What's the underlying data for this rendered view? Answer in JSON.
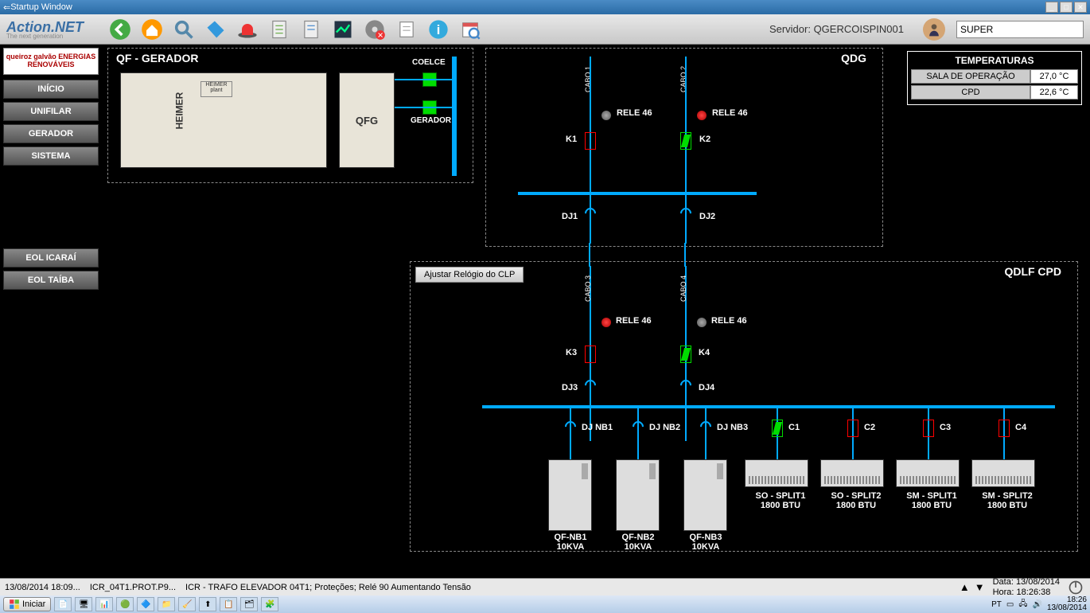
{
  "window": {
    "title": "Startup Window"
  },
  "toolbar": {
    "logo": "Action.NET",
    "logo_sub": "The next generation",
    "server_label": "Servidor: QGERCOISPIN001",
    "user_input": "SUPER"
  },
  "sidebar": {
    "company": "queiroz galvão ENERGIAS RENOVÁVEIS",
    "buttons": [
      "INÍCIO",
      "UNIFILAR",
      "GERADOR",
      "SISTEMA"
    ],
    "eol_buttons": [
      "EOL ICARAÍ",
      "EOL TAÍBA"
    ]
  },
  "panels": {
    "qf_gerador": {
      "title": "QF - GERADOR",
      "gen_label": "HEIMER",
      "gen_plate": "HEIMER plant",
      "qfg": "QFG",
      "coelce": "COELCE",
      "gerador": "GERADOR"
    },
    "qdg": {
      "title": "QDG",
      "cabo1": "CABO 1",
      "cabo2": "CABO 2",
      "rele1": "RELE 46",
      "rele2": "RELE 46",
      "k1": "K1",
      "k2": "K2",
      "dj1": "DJ1",
      "dj2": "DJ2"
    },
    "qdlf": {
      "title": "QDLF CPD",
      "clp_btn": "Ajustar Relógio do CLP",
      "cabo3": "CABO 3",
      "cabo4": "CABO 4",
      "rele3": "RELE 46",
      "rele4": "RELE 46",
      "k3": "K3",
      "k4": "K4",
      "dj3": "DJ3",
      "dj4": "DJ4",
      "djnb1": "DJ NB1",
      "djnb2": "DJ NB2",
      "djnb3": "DJ NB3",
      "c1": "C1",
      "c2": "C2",
      "c3": "C3",
      "c4": "C4",
      "loads": [
        {
          "name": "QF-NB1",
          "sub": "10KVA"
        },
        {
          "name": "QF-NB2",
          "sub": "10KVA"
        },
        {
          "name": "QF-NB3",
          "sub": "10KVA"
        }
      ],
      "ac_units": [
        {
          "name": "SO - SPLIT1",
          "sub": "1800 BTU"
        },
        {
          "name": "SO - SPLIT2",
          "sub": "1800 BTU"
        },
        {
          "name": "SM - SPLIT1",
          "sub": "1800 BTU"
        },
        {
          "name": "SM - SPLIT2",
          "sub": "1800 BTU"
        }
      ]
    }
  },
  "temperatures": {
    "title": "TEMPERATURAS",
    "rows": [
      {
        "label": "SALA DE OPERAÇÃO",
        "value": "27,0 °C"
      },
      {
        "label": "CPD",
        "value": "22,6 °C"
      }
    ]
  },
  "statusbar": {
    "time": "13/08/2014 18:09...",
    "code": "ICR_04T1.PROT.P9...",
    "msg": "ICR - TRAFO ELEVADOR 04T1; Proteções; Relé 90 Aumentando Tensão",
    "date_label": "Data:",
    "date_val": "13/08/2014",
    "hour_label": "Hora:",
    "hour_val": "18:26:38"
  },
  "taskbar": {
    "start": "Iniciar",
    "lang": "PT",
    "clock_time": "18:26",
    "clock_date": "13/08/2014"
  }
}
